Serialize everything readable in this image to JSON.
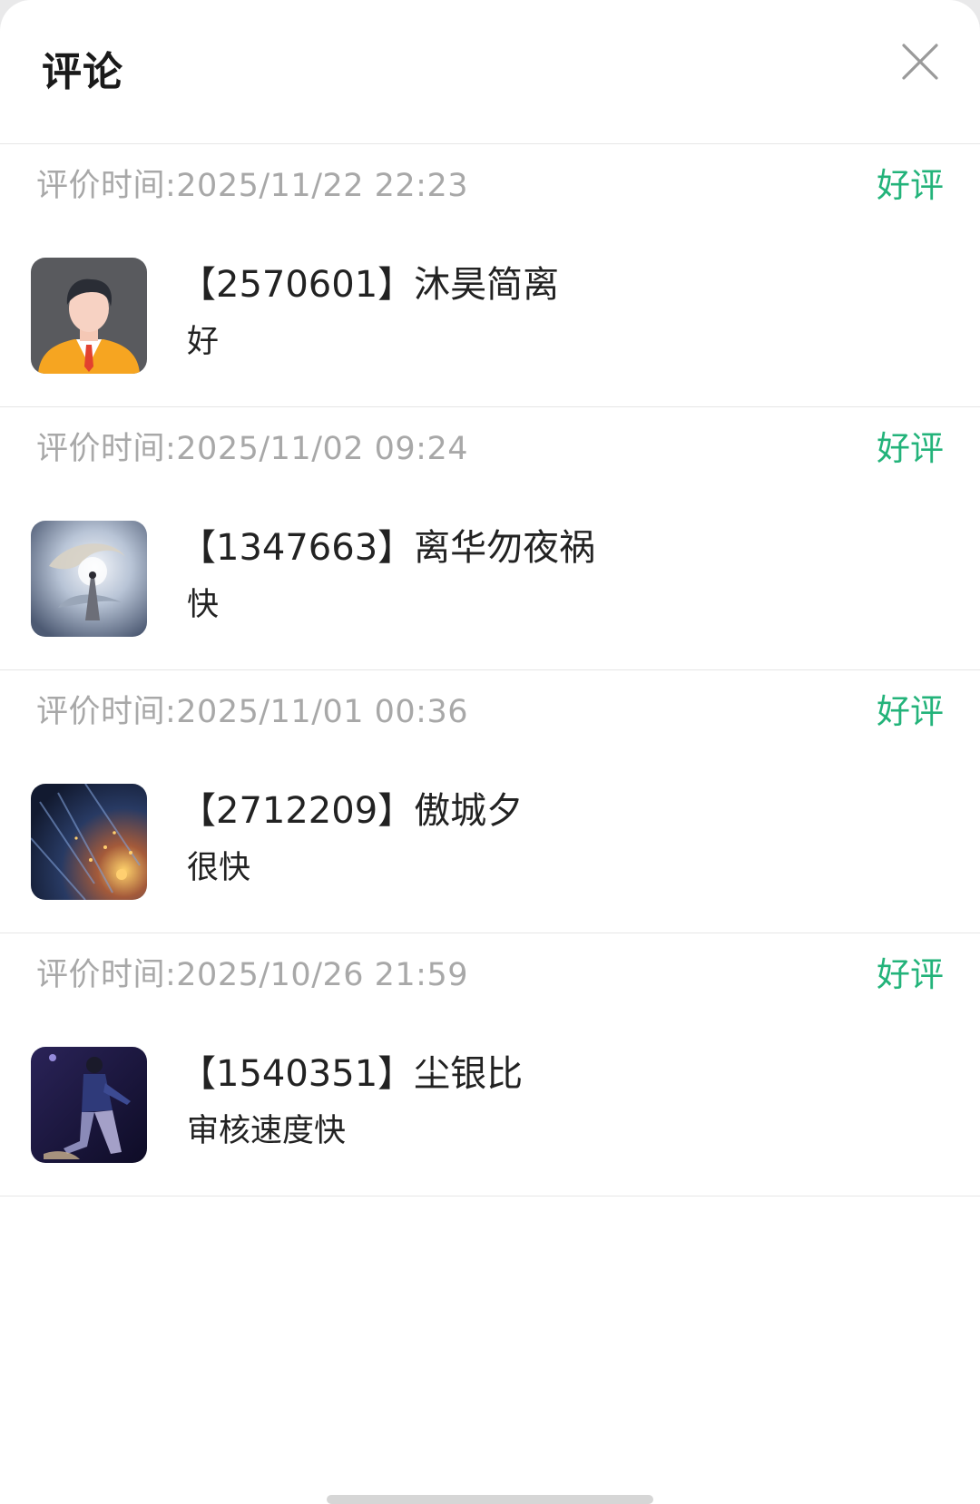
{
  "header": {
    "title": "评论",
    "close_icon": "close-icon"
  },
  "reviews": [
    {
      "time": "评价时间:2025/11/22 22:23",
      "rating": "好评",
      "user": "【2570601】沐昊简离",
      "content": "好",
      "avatar_icon": "default-person-avatar"
    },
    {
      "time": "评价时间:2025/11/02 09:24",
      "rating": "好评",
      "user": "【1347663】离华勿夜祸",
      "content": "快",
      "avatar_icon": "dragon-art-avatar"
    },
    {
      "time": "评价时间:2025/11/01 00:36",
      "rating": "好评",
      "user": "【2712209】傲城夕",
      "content": "很快",
      "avatar_icon": "sparkle-art-avatar"
    },
    {
      "time": "评价时间:2025/10/26 21:59",
      "rating": "好评",
      "user": "【1540351】尘银比",
      "content": "审核速度快",
      "avatar_icon": "dancer-photo-avatar"
    }
  ],
  "colors": {
    "rating_green": "#23b37a",
    "time_gray": "#a8a8a8",
    "text_dark": "#222222",
    "divider": "#e6e6e6"
  }
}
